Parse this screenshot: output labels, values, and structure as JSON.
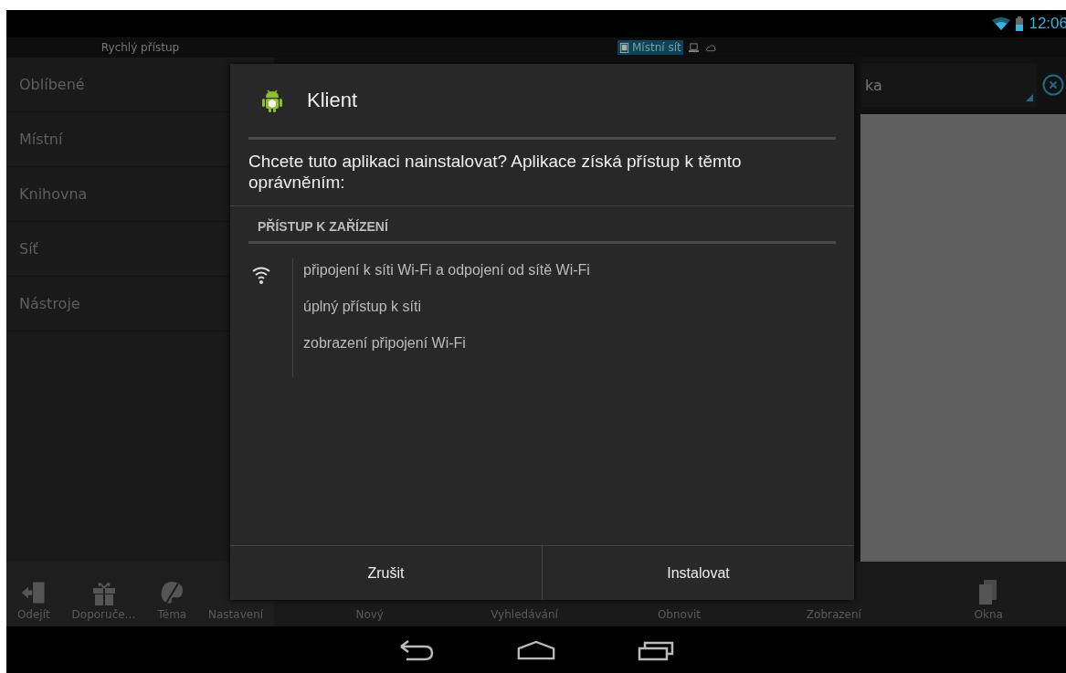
{
  "status_bar": {
    "time": "12:06"
  },
  "quick_access": {
    "title": "Rychlý přístup"
  },
  "location_tabs": [
    {
      "kind": "device",
      "label": "Místní sít",
      "selected": true
    },
    {
      "kind": "computer",
      "selected": false
    },
    {
      "kind": "cloud",
      "selected": false
    }
  ],
  "path_field": {
    "value": "ka"
  },
  "sidebar": {
    "items": [
      {
        "label": "Oblíbené"
      },
      {
        "label": "Místní"
      },
      {
        "label": "Knihovna"
      },
      {
        "label": "Síť"
      },
      {
        "label": "Nástroje"
      }
    ]
  },
  "dialog": {
    "title": "Klient",
    "message": "Chcete tuto aplikaci nainstalovat? Aplikace získá přístup k těmto oprávněním:",
    "section": "PŘÍSTUP K ZAŘÍZENÍ",
    "permissions": [
      "připojení k síti Wi-Fi a odpojení od sítě Wi-Fi",
      "úplný přístup k síti",
      "zobrazení připojení Wi-Fi"
    ],
    "buttons": [
      "Zrušit",
      "Instalovat"
    ]
  },
  "toolbar": [
    {
      "label": "Odejít",
      "kind": "exit"
    },
    {
      "label": "Doporuče…",
      "kind": "gift"
    },
    {
      "label": "Téma",
      "kind": "palette"
    },
    {
      "label": "Nastavení"
    },
    {
      "label": "Nový"
    },
    {
      "label": "Vyhledávání"
    },
    {
      "label": "Obnovit"
    },
    {
      "label": "Zobrazení"
    },
    {
      "label": "Okna",
      "kind": "windows"
    }
  ]
}
